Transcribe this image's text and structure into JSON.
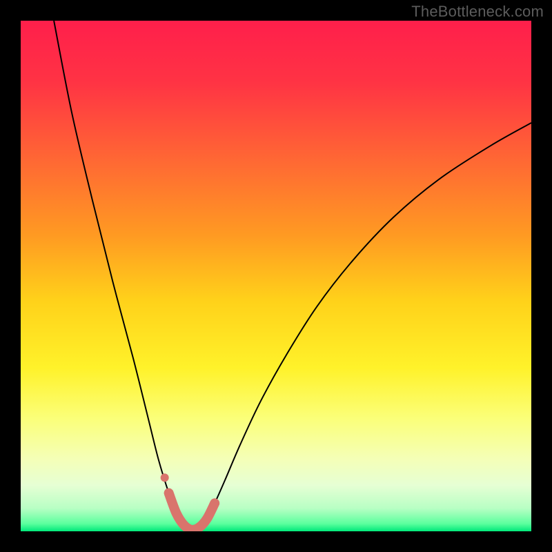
{
  "watermark": "TheBottleneck.com",
  "colors": {
    "highlight": "#d9746c",
    "curve": "#000000",
    "gradient_stops": [
      {
        "offset": 0.0,
        "color": "#ff1f4b"
      },
      {
        "offset": 0.12,
        "color": "#ff3344"
      },
      {
        "offset": 0.28,
        "color": "#ff6a33"
      },
      {
        "offset": 0.42,
        "color": "#ff9a22"
      },
      {
        "offset": 0.55,
        "color": "#ffd21a"
      },
      {
        "offset": 0.68,
        "color": "#fff22a"
      },
      {
        "offset": 0.78,
        "color": "#fbff7a"
      },
      {
        "offset": 0.86,
        "color": "#f4ffb8"
      },
      {
        "offset": 0.91,
        "color": "#e6ffd4"
      },
      {
        "offset": 0.955,
        "color": "#b8ffc4"
      },
      {
        "offset": 0.985,
        "color": "#5cff9e"
      },
      {
        "offset": 1.0,
        "color": "#00e87a"
      }
    ]
  },
  "chart_data": {
    "type": "line",
    "title": "",
    "xlabel": "",
    "ylabel": "",
    "xlim": [
      0,
      100
    ],
    "ylim": [
      0,
      100
    ],
    "note": "x/y are in percent of the plot area (y = 0 at bottom, y = 100 at top). Curve represents bottleneck percentage vs. component balance; optimum at trough near x ≈ 33.",
    "series": [
      {
        "name": "bottleneck-curve",
        "x": [
          6.5,
          10,
          14,
          18,
          22,
          25,
          27,
          29,
          30.5,
          32,
          33.5,
          35,
          36.5,
          38,
          40,
          43,
          47,
          52,
          58,
          65,
          73,
          82,
          92,
          100
        ],
        "y": [
          100,
          82,
          65,
          49,
          34,
          22,
          14,
          7.5,
          3.5,
          1.2,
          0.3,
          0.8,
          2.5,
          5.5,
          10,
          17,
          25.5,
          34.5,
          44,
          53,
          61.5,
          69,
          75.5,
          80
        ]
      }
    ],
    "highlight": {
      "segment_x": [
        29,
        30.5,
        32,
        33.5,
        35,
        36.5,
        38
      ],
      "segment_y": [
        7.5,
        3.5,
        1.2,
        0.3,
        0.8,
        2.5,
        5.5
      ],
      "dot": {
        "x": 28.2,
        "y": 10.5
      }
    }
  }
}
